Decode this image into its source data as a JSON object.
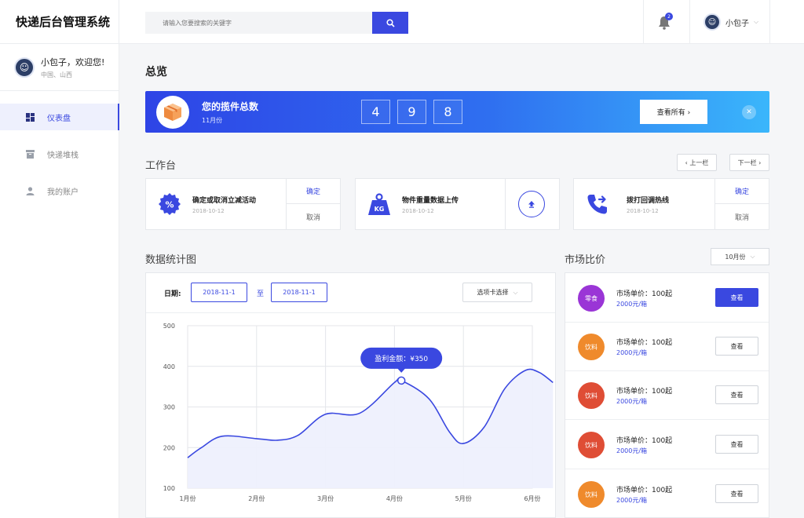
{
  "app": {
    "title": "快递后台管理系统"
  },
  "user": {
    "greeting": "小包子，欢迎您!",
    "location": "中国、山西",
    "avatar_glyph": "☺"
  },
  "sidebar": {
    "items": [
      {
        "label": "仪表盘",
        "icon": "dashboard-icon",
        "active": true
      },
      {
        "label": "快递堆栈",
        "icon": "archive-box-icon",
        "active": false
      },
      {
        "label": "我的账户",
        "icon": "user-icon",
        "active": false
      }
    ]
  },
  "topbar": {
    "search_placeholder": "请输入您要搜索的关键字",
    "notification_count": "2",
    "user_name": "小包子"
  },
  "overview": {
    "title": "总览",
    "banner_title": "您的揽件总数",
    "banner_sub": "11月份",
    "digits": [
      "4",
      "9",
      "8"
    ],
    "view_all": "查看所有 ›"
  },
  "workbench": {
    "title": "工作台",
    "prev": "‹ 上一栏",
    "next": "下一栏 ›",
    "tasks": [
      {
        "name": "确定或取消立减活动",
        "date": "2018-10-12",
        "confirm": "确定",
        "cancel": "取消"
      },
      {
        "name": "物件重量数据上传",
        "date": "2018-10-12"
      },
      {
        "name": "拨打回调热线",
        "date": "2018-10-12",
        "confirm": "确定",
        "cancel": "取消"
      }
    ]
  },
  "stats": {
    "title": "数据统计图",
    "date_label": "日期:",
    "date_from": "2018-11-1",
    "date_sep": "至",
    "date_to": "2018-11-1",
    "tab_select": "选项卡选择"
  },
  "market": {
    "title": "市场比价",
    "month": "10月份",
    "rows": [
      {
        "badge": "零食",
        "color": "#9a35d6",
        "price": "市场单价：100起",
        "unit": "2000元/箱",
        "button": "查看",
        "primary": true
      },
      {
        "badge": "饮料",
        "color": "#ef8a2c",
        "price": "市场单价：100起",
        "unit": "2000元/箱",
        "button": "查看",
        "primary": false
      },
      {
        "badge": "饮料",
        "color": "#df4d35",
        "price": "市场单价：100起",
        "unit": "2000元/箱",
        "button": "查看",
        "primary": false
      },
      {
        "badge": "饮料",
        "color": "#df4d35",
        "price": "市场单价：100起",
        "unit": "2000元/箱",
        "button": "查看",
        "primary": false
      },
      {
        "badge": "饮料",
        "color": "#ef8a2c",
        "price": "市场单价：100起",
        "unit": "2000元/箱",
        "button": "查看",
        "primary": false
      }
    ]
  },
  "chart_data": {
    "type": "area",
    "x": [
      "1月份",
      "2月份",
      "3月份",
      "4月份",
      "5月份",
      "6月份"
    ],
    "y_ticks": [
      500,
      400,
      300,
      200,
      100
    ],
    "ylim": [
      100,
      500
    ],
    "points": [
      [
        0.0,
        175
      ],
      [
        0.2,
        200
      ],
      [
        0.5,
        228
      ],
      [
        1.0,
        222
      ],
      [
        1.3,
        218
      ],
      [
        1.6,
        230
      ],
      [
        2.0,
        282
      ],
      [
        2.5,
        285
      ],
      [
        3.0,
        360
      ],
      [
        3.1,
        365
      ],
      [
        3.5,
        320
      ],
      [
        3.8,
        238
      ],
      [
        4.0,
        210
      ],
      [
        4.3,
        250
      ],
      [
        4.6,
        345
      ],
      [
        4.9,
        390
      ],
      [
        5.1,
        385
      ],
      [
        5.3,
        360
      ]
    ],
    "highlight": {
      "x": 3.1,
      "y": 365,
      "label": "盈利金额：¥350"
    },
    "line_color": "#3a48e0",
    "fill_color": "#eef0fd"
  }
}
